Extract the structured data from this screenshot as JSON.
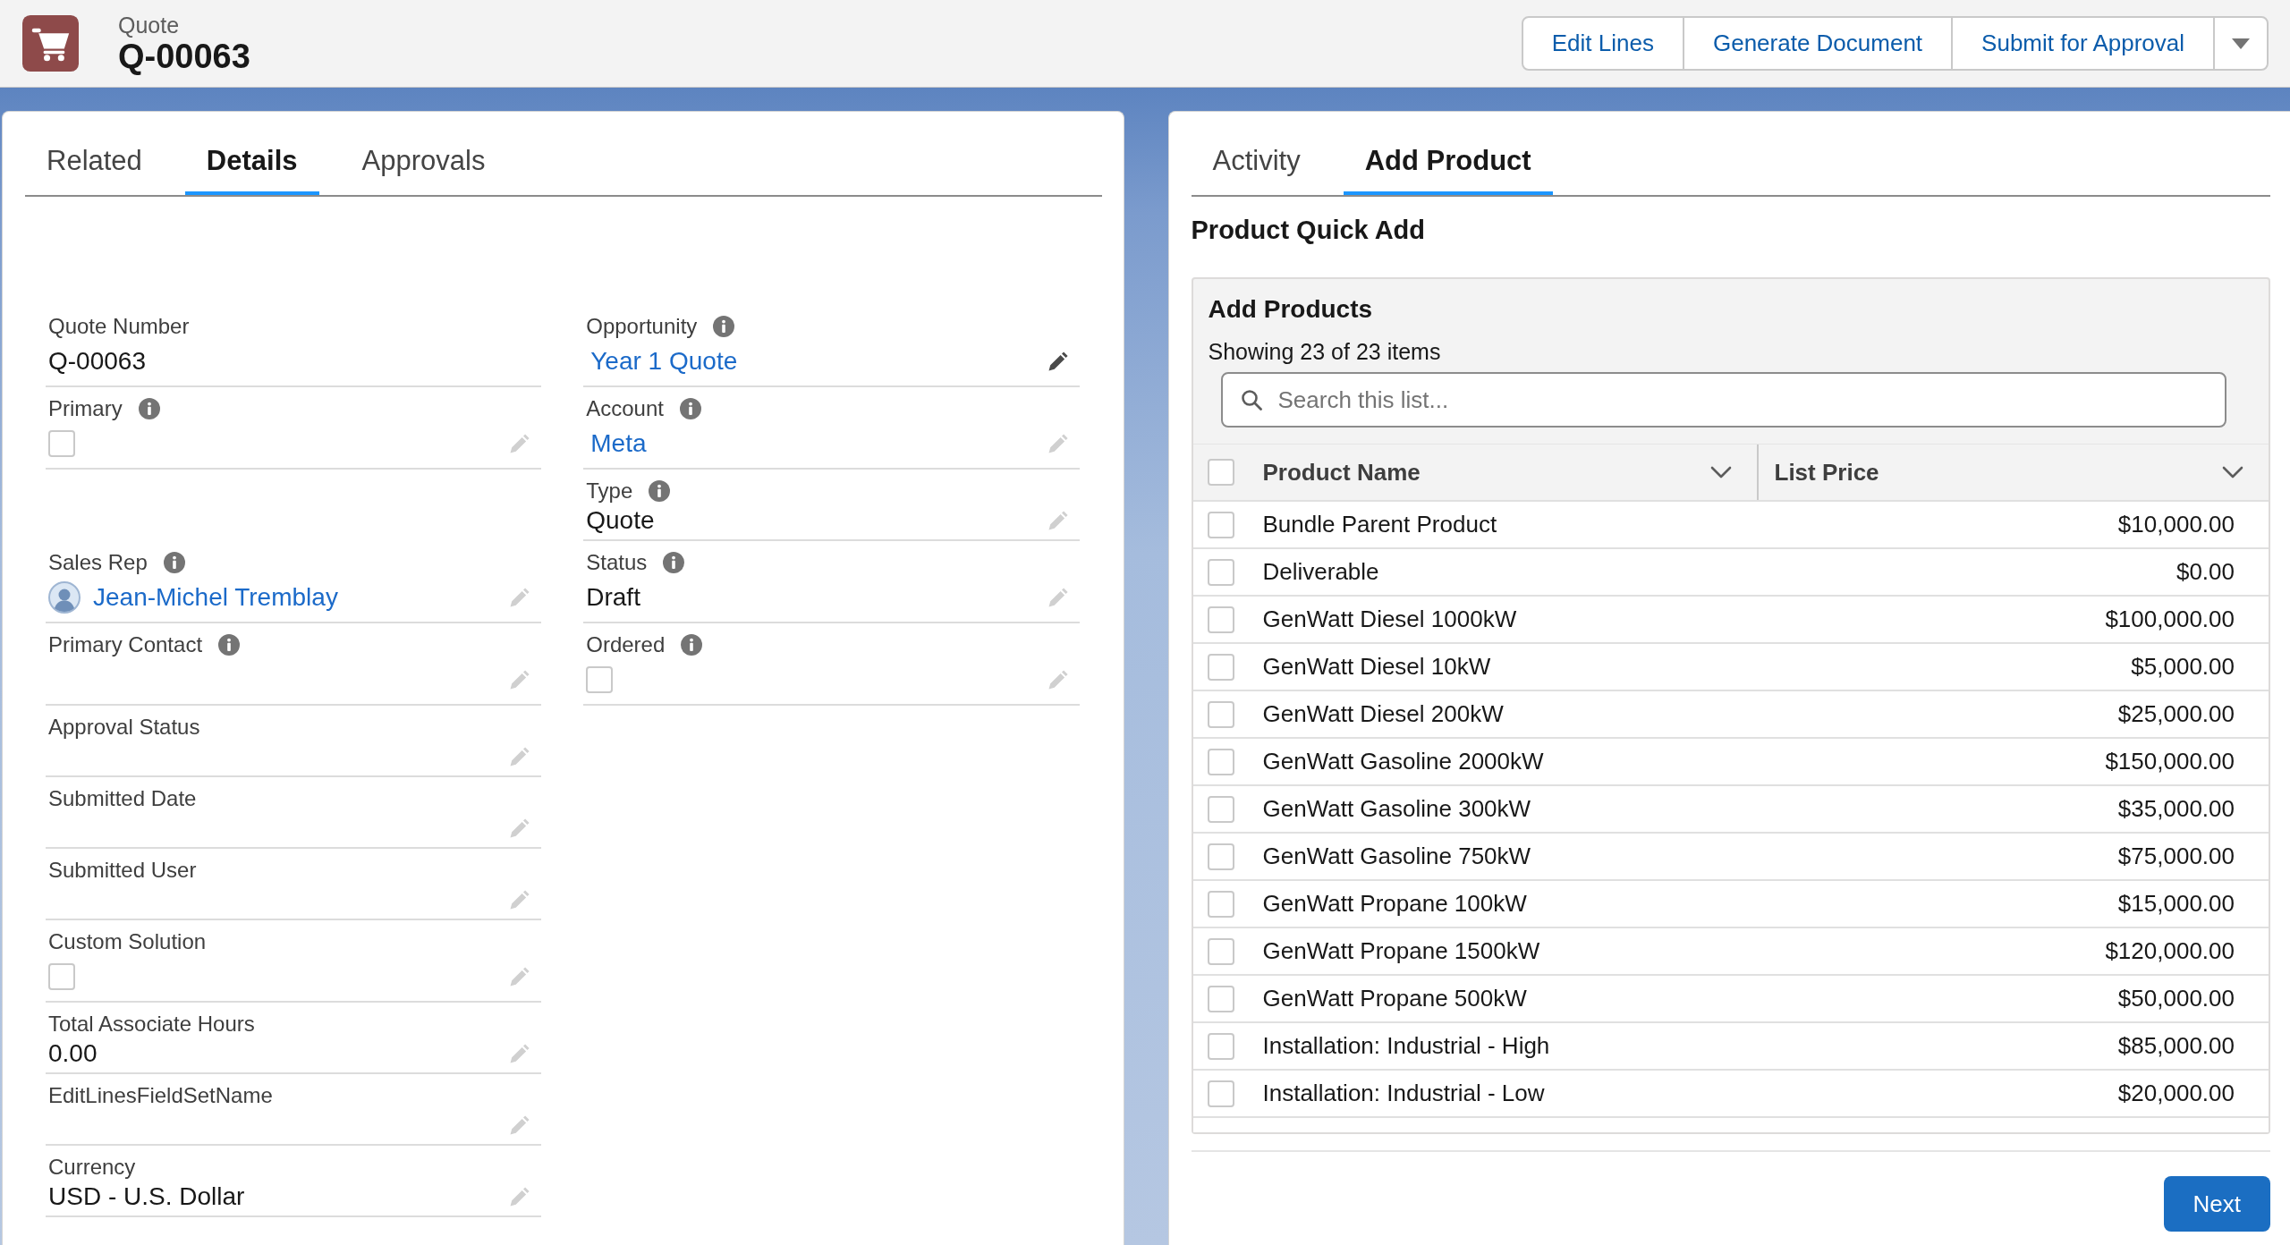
{
  "header": {
    "object_label": "Quote",
    "record_name": "Q-00063",
    "actions": [
      "Edit Lines",
      "Generate Document",
      "Submit for Approval"
    ]
  },
  "left_panel": {
    "tabs": [
      {
        "label": "Related",
        "selected": false
      },
      {
        "label": "Details",
        "selected": true
      },
      {
        "label": "Approvals",
        "selected": false
      }
    ],
    "rows": [
      {
        "left": {
          "label": "Quote Number",
          "kind": "text",
          "value": "Q-00063",
          "info": false,
          "editable": false
        },
        "right": {
          "label": "Opportunity",
          "kind": "link",
          "value": "Year 1 Quote",
          "info": true,
          "editable": true,
          "hovered": true
        }
      },
      {
        "left": {
          "label": "Primary",
          "kind": "checkbox",
          "checked": false,
          "info": true,
          "editable": true,
          "hovered": false
        },
        "right": {
          "label": "Account",
          "kind": "link",
          "value": "Meta",
          "info": true,
          "editable": true,
          "hovered": false
        }
      },
      {
        "right": {
          "label": "Type",
          "kind": "text",
          "value": "Quote",
          "info": true,
          "editable": true,
          "hovered": false
        }
      },
      {
        "left": {
          "label": "Sales Rep",
          "kind": "user",
          "value": "Jean-Michel Tremblay",
          "info": true,
          "editable": true,
          "hovered": false
        },
        "right": {
          "label": "Status",
          "kind": "text",
          "value": "Draft",
          "info": true,
          "editable": true,
          "hovered": false
        }
      },
      {
        "left": {
          "label": "Primary Contact",
          "kind": "empty",
          "info": true,
          "editable": true,
          "hovered": false
        },
        "right": {
          "label": "Ordered",
          "kind": "checkbox",
          "checked": false,
          "info": true,
          "editable": true,
          "hovered": false
        }
      },
      {
        "left": {
          "label": "Approval Status",
          "kind": "empty",
          "info": false,
          "editable": true,
          "hovered": false
        }
      },
      {
        "left": {
          "label": "Submitted Date",
          "kind": "empty",
          "info": false,
          "editable": true,
          "hovered": false
        }
      },
      {
        "left": {
          "label": "Submitted User",
          "kind": "empty",
          "info": false,
          "editable": true,
          "hovered": false
        }
      },
      {
        "left": {
          "label": "Custom Solution",
          "kind": "checkbox",
          "checked": false,
          "info": false,
          "editable": true,
          "hovered": false
        }
      },
      {
        "left": {
          "label": "Total Associate Hours",
          "kind": "text",
          "value": "0.00",
          "info": false,
          "editable": true,
          "hovered": false
        }
      },
      {
        "left": {
          "label": "EditLinesFieldSetName",
          "kind": "empty",
          "info": false,
          "editable": true,
          "hovered": false
        }
      },
      {
        "left": {
          "label": "Currency",
          "kind": "text",
          "value": "USD - U.S. Dollar",
          "info": false,
          "editable": true,
          "hovered": false
        }
      }
    ]
  },
  "right_panel": {
    "tabs": [
      {
        "label": "Activity",
        "selected": false
      },
      {
        "label": "Add Product",
        "selected": true
      }
    ],
    "title": "Product Quick Add",
    "list": {
      "title": "Add Products",
      "count": "Showing 23 of 23 items",
      "search": {
        "placeholder": "Search this list..."
      },
      "columns": [
        "Product Name",
        "List Price"
      ],
      "all_checked": false,
      "rows": [
        {
          "name": "Bundle Parent Product",
          "price": "$10,000.00",
          "checked": false
        },
        {
          "name": "Deliverable",
          "price": "$0.00",
          "checked": false
        },
        {
          "name": "GenWatt Diesel 1000kW",
          "price": "$100,000.00",
          "checked": false
        },
        {
          "name": "GenWatt Diesel 10kW",
          "price": "$5,000.00",
          "checked": false
        },
        {
          "name": "GenWatt Diesel 200kW",
          "price": "$25,000.00",
          "checked": false
        },
        {
          "name": "GenWatt Gasoline 2000kW",
          "price": "$150,000.00",
          "checked": false
        },
        {
          "name": "GenWatt Gasoline 300kW",
          "price": "$35,000.00",
          "checked": false
        },
        {
          "name": "GenWatt Gasoline 750kW",
          "price": "$75,000.00",
          "checked": false
        },
        {
          "name": "GenWatt Propane 100kW",
          "price": "$15,000.00",
          "checked": false
        },
        {
          "name": "GenWatt Propane 1500kW",
          "price": "$120,000.00",
          "checked": false
        },
        {
          "name": "GenWatt Propane 500kW",
          "price": "$50,000.00",
          "checked": false
        },
        {
          "name": "Installation: Industrial - High",
          "price": "$85,000.00",
          "checked": false
        },
        {
          "name": "Installation: Industrial - Low",
          "price": "$20,000.00",
          "checked": false
        }
      ]
    },
    "next_button": "Next"
  }
}
